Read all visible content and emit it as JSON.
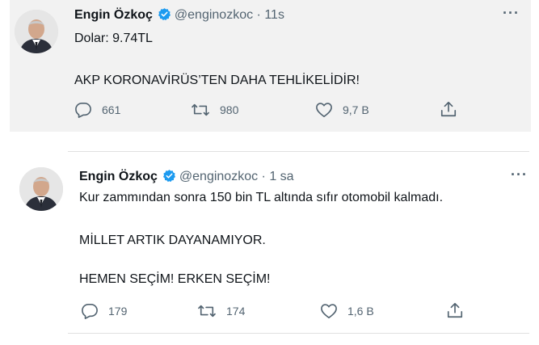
{
  "tweets": [
    {
      "name": "Engin Özkoç",
      "handle": "@enginozkoc",
      "separator": "·",
      "time": "11s",
      "more": "···",
      "lines": [
        "Dolar: 9.74TL",
        "AKP KORONAVİRÜS’TEN DAHA TEHLİKELİDİR!"
      ],
      "actions": {
        "reply": "661",
        "retweet": "980",
        "like": "9,7 B"
      }
    },
    {
      "name": "Engin Özkoç",
      "handle": "@enginozkoc",
      "separator": "·",
      "time": "1 sa",
      "more": "···",
      "lines": [
        "Kur zammından sonra 150 bin TL altında sıfır otomobil kalmadı.",
        "MİLLET ARTIK DAYANAMIYOR.",
        "HEMEN SEÇİM! ERKEN SEÇİM!"
      ],
      "actions": {
        "reply": "179",
        "retweet": "174",
        "like": "1,6 B"
      }
    }
  ],
  "icons": {
    "verified": "verified-badge-icon",
    "reply": "reply-icon",
    "retweet": "retweet-icon",
    "like": "heart-icon",
    "share": "share-icon"
  },
  "colors": {
    "verified_blue": "#1d9bf0",
    "muted": "#536471",
    "text": "#0f1419",
    "first_tweet_bg": "#f2f2f2"
  }
}
